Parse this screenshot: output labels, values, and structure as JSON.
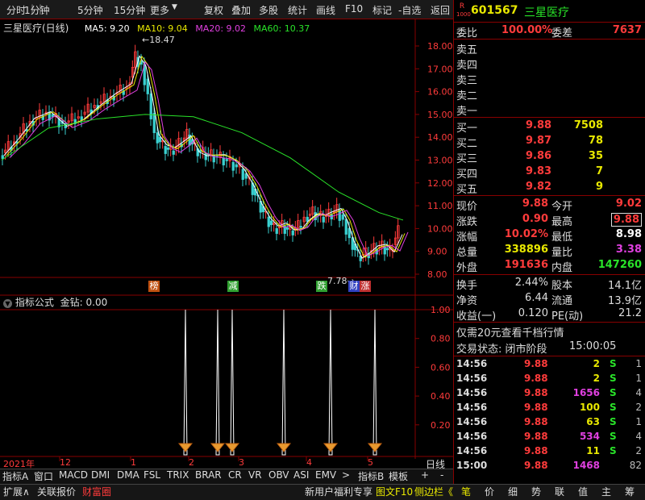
{
  "toolbar": {
    "items": [
      "分时",
      "1分钟",
      "5分钟",
      "15分钟",
      "更多",
      "复权",
      "叠加",
      "多股",
      "统计",
      "画线",
      "F10",
      "标记",
      "-自选",
      "返回"
    ]
  },
  "chart_title": {
    "name": "三星医疗(日线)",
    "ma5": "MA5: 9.20",
    "ma10": "MA10: 9.04",
    "ma20": "MA20: 9.02",
    "ma60": "MA60: 10.37"
  },
  "colors": {
    "ma5": "#ffffff",
    "ma10": "#e8e800",
    "ma20": "#e040e0",
    "ma60": "#29e329",
    "up": "#ff3b3b",
    "down": "#3ad0d0",
    "grid": "#800000"
  },
  "price_axis": [
    "18.00",
    "17.00",
    "16.00",
    "15.00",
    "14.00",
    "13.00",
    "12.00",
    "11.00",
    "10.00",
    "9.00",
    "8.00"
  ],
  "annotations": {
    "high": "18.47",
    "low": "7.78"
  },
  "markers": [
    {
      "t": "榜",
      "c": "#c05010"
    },
    {
      "t": "减",
      "c": "#30a030"
    },
    {
      "t": "跌",
      "c": "#30a030"
    },
    {
      "t": "财",
      "c": "#3040c0"
    },
    {
      "t": "涨",
      "c": "#c03030"
    }
  ],
  "indicator": {
    "title": "指标公式",
    "value": "金钻: 0.00",
    "axis": [
      "1.00",
      "0.80",
      "0.60",
      "0.40",
      "0.20"
    ]
  },
  "time_axis": {
    "labels": [
      "2021年",
      "12",
      "1",
      "2",
      "3",
      "4",
      "5"
    ],
    "period": "日线"
  },
  "bottom_tabs": [
    "指标A",
    "窗口",
    "MACD",
    "DMI",
    "DMA",
    "FSL",
    "TRIX",
    "BRAR",
    "CR",
    "VR",
    "OBV",
    "ASI",
    "EMV",
    ">",
    "指标B",
    "模板",
    "+",
    "-"
  ],
  "footer": {
    "left": [
      "扩展∧",
      "关联报价",
      "财富圈"
    ],
    "right": [
      "新用户福利专享",
      "图文F10",
      "侧边栏《"
    ],
    "icons": [
      "笔",
      "价",
      "细",
      "势",
      "联",
      "值",
      "主",
      "筹"
    ]
  },
  "stock": {
    "code": "601567",
    "name": "三星医疗",
    "badge_top": "R",
    "badge_bottom": "1000"
  },
  "weibi": {
    "label": "委比",
    "value": "100.00%",
    "label2": "委差",
    "value2": "7637"
  },
  "sell": [
    {
      "l": "卖五"
    },
    {
      "l": "卖四"
    },
    {
      "l": "卖三"
    },
    {
      "l": "卖二"
    },
    {
      "l": "卖一"
    }
  ],
  "buy": [
    {
      "l": "买一",
      "p": "9.88",
      "v": "7508"
    },
    {
      "l": "买二",
      "p": "9.87",
      "v": "78"
    },
    {
      "l": "买三",
      "p": "9.86",
      "v": "35"
    },
    {
      "l": "买四",
      "p": "9.83",
      "v": "7"
    },
    {
      "l": "买五",
      "p": "9.82",
      "v": "9"
    }
  ],
  "quote": [
    {
      "l1": "现价",
      "v1": "9.88",
      "l2": "今开",
      "v2": "9.02"
    },
    {
      "l1": "涨跌",
      "v1": "0.90",
      "l2": "最高",
      "v2": "9.88"
    },
    {
      "l1": "涨幅",
      "v1": "10.02%",
      "l2": "最低",
      "v2": "8.98"
    },
    {
      "l1": "总量",
      "v1": "338896",
      "l2": "量比",
      "v2": "3.38"
    },
    {
      "l1": "外盘",
      "v1": "191636",
      "l2": "内盘",
      "v2": "147260"
    }
  ],
  "fund": [
    {
      "l1": "换手",
      "v1": "2.44%",
      "l2": "股本",
      "v2": "14.1亿"
    },
    {
      "l1": "净资",
      "v1": "6.44",
      "l2": "流通",
      "v2": "13.9亿"
    },
    {
      "l1": "收益(一)",
      "v1": "0.120",
      "l2": "PE(动)",
      "v2": "21.2"
    }
  ],
  "promo": "仅需20元查看千档行情",
  "trade_status": {
    "label": "交易状态: 闭市阶段",
    "time": "15:00:05"
  },
  "ticks": [
    {
      "t": "14:56",
      "p": "9.88",
      "v": "2",
      "s": "S",
      "n": "1"
    },
    {
      "t": "14:56",
      "p": "9.88",
      "v": "2",
      "s": "S",
      "n": "1"
    },
    {
      "t": "14:56",
      "p": "9.88",
      "v": "1656",
      "s": "S",
      "n": "4"
    },
    {
      "t": "14:56",
      "p": "9.88",
      "v": "100",
      "s": "S",
      "n": "2"
    },
    {
      "t": "14:56",
      "p": "9.88",
      "v": "63",
      "s": "S",
      "n": "1"
    },
    {
      "t": "14:56",
      "p": "9.88",
      "v": "534",
      "s": "S",
      "n": "4"
    },
    {
      "t": "14:56",
      "p": "9.88",
      "v": "11",
      "s": "S",
      "n": "2"
    },
    {
      "t": "15:00",
      "p": "9.88",
      "v": "1468",
      "s": "",
      "n": "82"
    }
  ]
}
